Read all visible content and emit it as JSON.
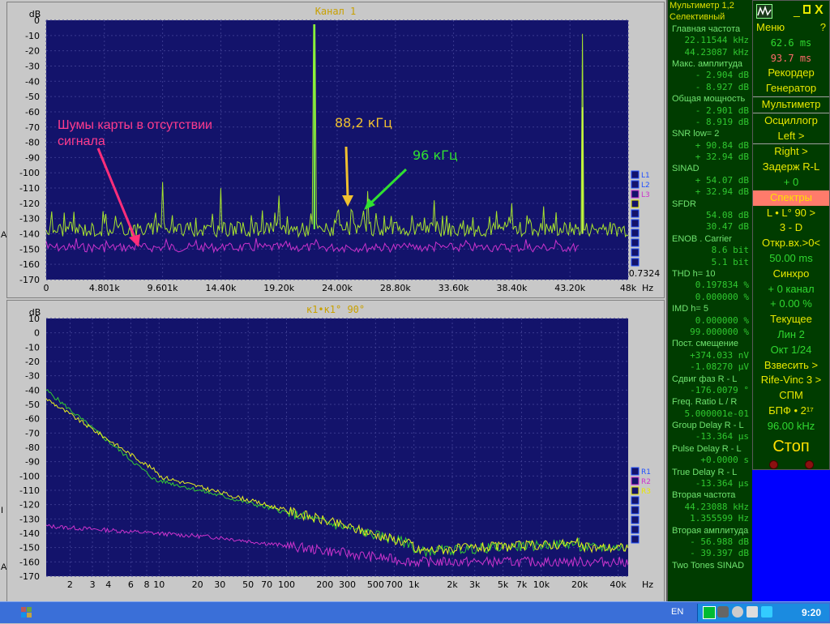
{
  "edge_labels": {
    "a1": "A",
    "a2": "A",
    "i": "I"
  },
  "top_graph": {
    "title": "Канал 1",
    "unit": "dB",
    "y_ticks": [
      "0",
      "-10",
      "-20",
      "-30",
      "-40",
      "-50",
      "-60",
      "-70",
      "-80",
      "-90",
      "-100",
      "-110",
      "-120",
      "-130",
      "-140",
      "-150",
      "-160",
      "-170"
    ],
    "x_ticks": [
      "0",
      "4.801k",
      "9.601k",
      "14.40k",
      "19.20k",
      "24.00k",
      "28.80k",
      "33.60k",
      "38.40k",
      "43.20k",
      "48k"
    ],
    "x_unit": "Hz",
    "corner_value": "0.7324",
    "legend": [
      "L1",
      "L2",
      "L3",
      "",
      "",
      "",
      "",
      "",
      "",
      ""
    ],
    "annotations": {
      "noise": "Шумы карты в отсутствии сигнала",
      "freq1": "88,2 кГц",
      "freq2": "96 кГц"
    }
  },
  "bottom_graph": {
    "title": "к1•к1° 90°",
    "unit": "dB",
    "y_ticks": [
      "10",
      "0",
      "-10",
      "-20",
      "-30",
      "-40",
      "-50",
      "-60",
      "-70",
      "-80",
      "-90",
      "-100",
      "-110",
      "-120",
      "-130",
      "-140",
      "-150",
      "-160",
      "-170"
    ],
    "x_ticks": [
      "2",
      "3",
      "4",
      "6",
      "8",
      "10",
      "20",
      "30",
      "50",
      "70",
      "100",
      "200",
      "300",
      "500",
      "700",
      "1k",
      "2k",
      "3k",
      "5k",
      "7k",
      "10k",
      "20k",
      "40k"
    ],
    "x_unit": "Hz",
    "legend": [
      "R1",
      "R2",
      "R3",
      "",
      "",
      "",
      "",
      ""
    ]
  },
  "multimeter": [
    {
      "t": "hdr",
      "text": "Мультиметр 1,2"
    },
    {
      "t": "hdr",
      "text": "Селективный"
    },
    {
      "t": "lbl",
      "text": "Главная частота"
    },
    {
      "t": "val",
      "text": "22.11544 kHz"
    },
    {
      "t": "val",
      "text": "44.23087 kHz"
    },
    {
      "t": "lbl",
      "text": "Макс. амплитуда"
    },
    {
      "t": "val",
      "text": "- 2.904 dB"
    },
    {
      "t": "val",
      "text": "- 8.927 dB"
    },
    {
      "t": "lbl",
      "text": "Общая мощность"
    },
    {
      "t": "val",
      "text": "- 2.901 dB"
    },
    {
      "t": "val",
      "text": "- 8.919 dB"
    },
    {
      "t": "lbl",
      "text": "SNR    low= 2"
    },
    {
      "t": "val",
      "text": "+ 90.84 dB"
    },
    {
      "t": "val",
      "text": "+ 32.94 dB"
    },
    {
      "t": "lbl",
      "text": "SINAD"
    },
    {
      "t": "val",
      "text": "+ 54.07 dB"
    },
    {
      "t": "val",
      "text": "+ 32.94 dB"
    },
    {
      "t": "lbl",
      "text": "SFDR"
    },
    {
      "t": "val",
      "text": "54.08 dB"
    },
    {
      "t": "val",
      "text": "30.47 dB"
    },
    {
      "t": "lbl",
      "text": "ENOB . Carrier"
    },
    {
      "t": "val",
      "text": "8.6 bit"
    },
    {
      "t": "val",
      "text": "5.1 bit"
    },
    {
      "t": "lbl",
      "text": "THD     h= 10"
    },
    {
      "t": "val",
      "text": "0.197834 %"
    },
    {
      "t": "val",
      "text": "0.000000 %"
    },
    {
      "t": "lbl",
      "text": "IMD      h= 5"
    },
    {
      "t": "val",
      "text": "0.000000 %"
    },
    {
      "t": "val",
      "text": "99.000000 %"
    },
    {
      "t": "lbl",
      "text": "Пост. смещение"
    },
    {
      "t": "val",
      "text": "+374.033 nV"
    },
    {
      "t": "val",
      "text": "-1.08270 µV"
    },
    {
      "t": "lbl",
      "text": "Сдвиг фаз R - L"
    },
    {
      "t": "val",
      "text": "-176.0079 °"
    },
    {
      "t": "lbl",
      "text": "Freq. Ratio  L / R"
    },
    {
      "t": "val",
      "text": "5.000001e-01"
    },
    {
      "t": "lbl",
      "text": "Group Delay R - L"
    },
    {
      "t": "val",
      "text": "-13.364 µs"
    },
    {
      "t": "lbl",
      "text": "Pulse Delay R - L"
    },
    {
      "t": "val",
      "text": "+0.0000  s"
    },
    {
      "t": "lbl",
      "text": "True Delay R - L"
    },
    {
      "t": "val",
      "text": "-13.364 µs"
    },
    {
      "t": "lbl",
      "text": "Вторая частота"
    },
    {
      "t": "val",
      "text": "44.23088 kHz"
    },
    {
      "t": "val",
      "text": "1.355599  Hz"
    },
    {
      "t": "lbl",
      "text": "Вторая амплитуда"
    },
    {
      "t": "val",
      "text": "- 56.988 dB"
    },
    {
      "t": "val",
      "text": "- 39.397 dB"
    },
    {
      "t": "lbl",
      "text": "Two Tones SINAD"
    }
  ],
  "control": {
    "menu": "Меню",
    "help": "?",
    "time1": "62.6 ms",
    "time2": "93.7 ms",
    "items": [
      {
        "text": "Рекордер",
        "c": "y"
      },
      {
        "text": "Генератор",
        "c": "y"
      },
      {
        "text": "Мультиметр",
        "c": "y",
        "sep": true
      },
      {
        "text": "Осциллогр",
        "c": "y",
        "sep": true
      },
      {
        "text": "Left      >",
        "c": "y"
      },
      {
        "text": "Right    >",
        "c": "y",
        "sep": true
      },
      {
        "text": "Задерж  R-L",
        "c": "y"
      },
      {
        "text": "+        0",
        "c": "g"
      },
      {
        "text": "Спектры",
        "c": "hl"
      },
      {
        "text": "L • L° 90  >",
        "c": "y"
      },
      {
        "text": "3 - D",
        "c": "y"
      },
      {
        "text": "Откр.вх.>0<",
        "c": "y"
      },
      {
        "text": "50.00 ms",
        "c": "g"
      },
      {
        "text": "Синхро",
        "c": "y"
      },
      {
        "text": "+  0 канал",
        "c": "g"
      },
      {
        "text": "+  0.00 %",
        "c": "g"
      },
      {
        "text": "Текущее",
        "c": "y"
      },
      {
        "text": "Лин        2",
        "c": "g"
      },
      {
        "text": "Окт   1/24",
        "c": "g"
      },
      {
        "text": "Взвесить  >",
        "c": "y"
      },
      {
        "text": "Rife-Vinc 3 >",
        "c": "y"
      },
      {
        "text": "СПМ",
        "c": "y"
      },
      {
        "text": "БПФ • 2¹⁷",
        "c": "y"
      },
      {
        "text": "96.00 kHz",
        "c": "g"
      }
    ],
    "stop": "Стоп"
  },
  "taskbar": {
    "lang": "EN",
    "clock": "9:20"
  }
}
